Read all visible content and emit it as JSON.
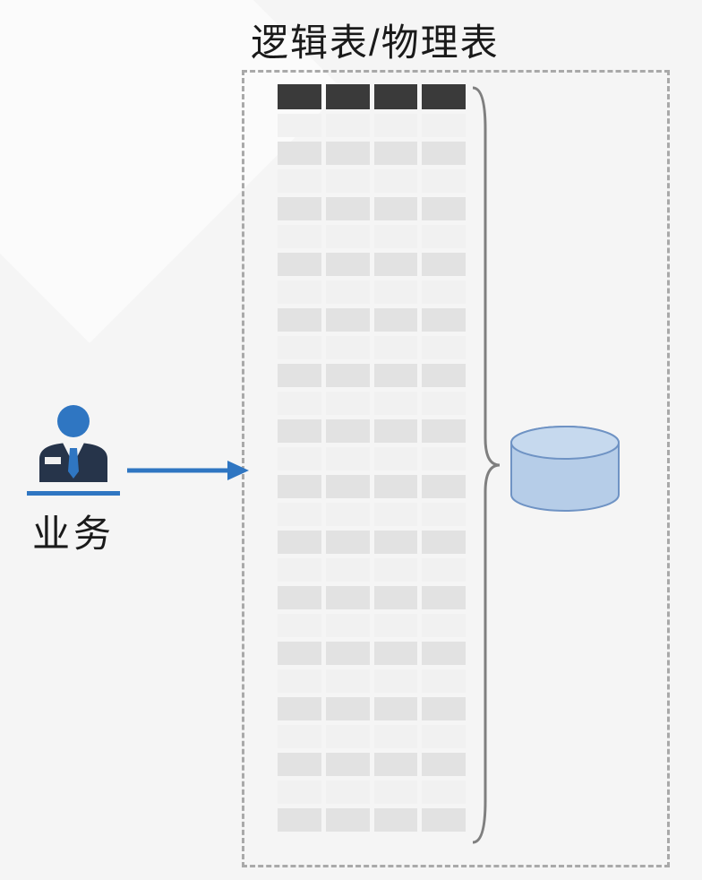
{
  "title": "逻辑表/物理表",
  "user_label": "业务",
  "colors": {
    "arrow": "#2f76c2",
    "user_fill": "#2f76c2",
    "user_dark": "#26344a",
    "db_fill": "#b6cde8",
    "db_stroke": "#6f93c4",
    "brace": "#7f7f7f"
  },
  "table": {
    "columns": 4,
    "header_rows": 1,
    "body_rows": 26
  }
}
